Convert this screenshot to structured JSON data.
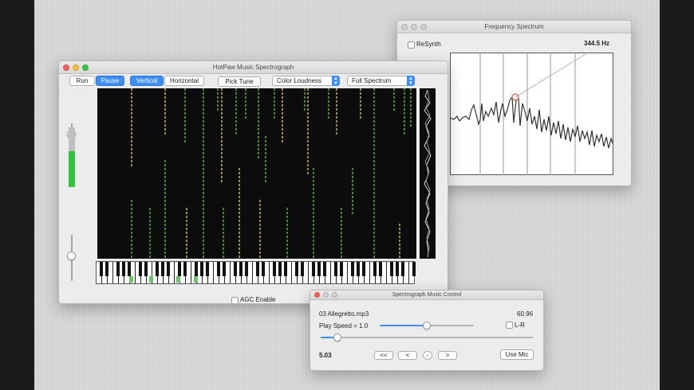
{
  "spectrograph_window": {
    "title": "HotPaw Music Spectrograph",
    "run_label": "Run",
    "pause_label": "Pause",
    "vertical_label": "Vertical",
    "horizontal_label": "Horizontal",
    "pick_tune_label": "Pick Tune",
    "color_mode": "Color Loudness",
    "spectrum_mode": "Full Spectrum",
    "agc_label": "AGC Enable",
    "level_meter_fraction": 0.6
  },
  "frequency_window": {
    "title": "Frequency Spectrum",
    "resynth_label": "ReSynth",
    "frequency_readout": "344.5 Hz"
  },
  "control_window": {
    "title": "Spectrograph Music Control",
    "track_name": "03 Allegretto.mp3",
    "duration": "60.96",
    "play_speed_label": "Play Speed = 1.0",
    "lr_label": "L-R",
    "position": "5.03",
    "rewind_label": "<<",
    "back_label": "<",
    "stop_label": "-",
    "forward_label": ">",
    "use_mic_label": "Use Mic",
    "speed_fraction": 0.5,
    "position_fraction": 0.08
  },
  "colors": {
    "accent": "#3e8ef7",
    "spectrum_green": "#6cc36a",
    "meter_green": "#31c13a"
  }
}
